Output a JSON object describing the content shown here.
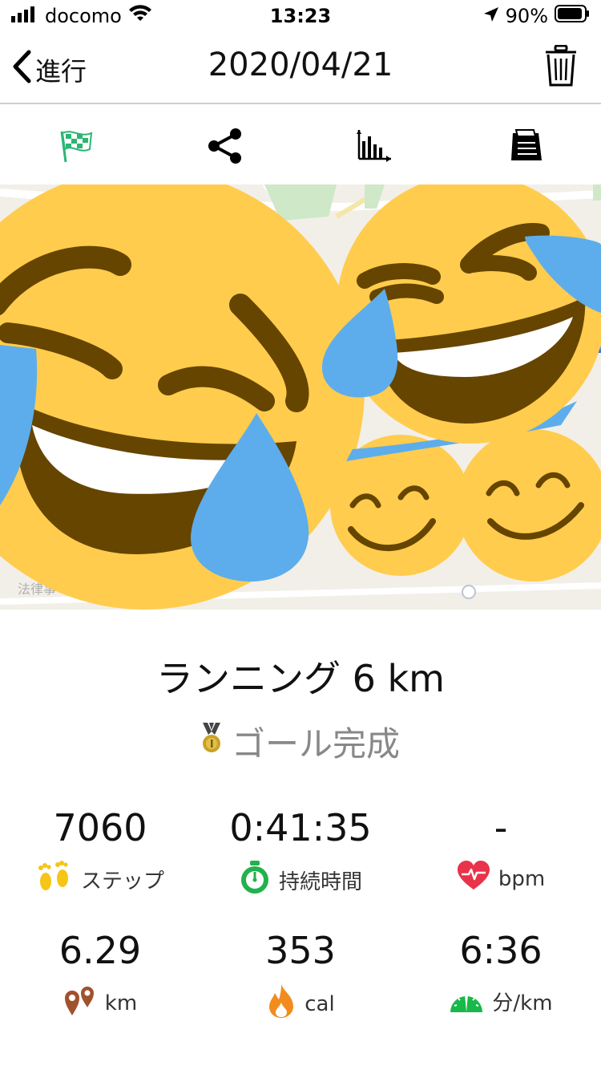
{
  "status_bar": {
    "carrier": "docomo",
    "time": "13:23",
    "battery": "90%"
  },
  "nav": {
    "back_label": "進行",
    "title": "2020/04/21"
  },
  "toolbar": {
    "icons": [
      "checkered-flag-icon",
      "share-icon",
      "bar-chart-icon",
      "receipt-icon"
    ]
  },
  "map": {
    "label": "法律事"
  },
  "activity": {
    "title": "ランニング 6 km",
    "goal_text": "ゴール完成"
  },
  "stats": [
    {
      "value": "7060",
      "label": "ステップ",
      "icon": "footprints-icon"
    },
    {
      "value": "0:41:35",
      "label": "持続時間",
      "icon": "stopwatch-icon"
    },
    {
      "value": "-",
      "label": "bpm",
      "icon": "heart-rate-icon"
    },
    {
      "value": "6.29",
      "label": "km",
      "icon": "map-pins-icon"
    },
    {
      "value": "353",
      "label": "cal",
      "icon": "flame-icon"
    },
    {
      "value": "6:36",
      "label": "分/km",
      "icon": "speedometer-icon"
    }
  ],
  "colors": {
    "flag_green": "#2bb673",
    "emoji_yellow": "#FFCC4D",
    "tear_blue": "#5DADEC",
    "heart_red": "#e8334a",
    "stopwatch_green": "#22b24c",
    "flame_orange": "#f28c1e",
    "pin_brown": "#a0522d",
    "speed_green": "#18b84a",
    "medal_gold": "#c9a227"
  }
}
